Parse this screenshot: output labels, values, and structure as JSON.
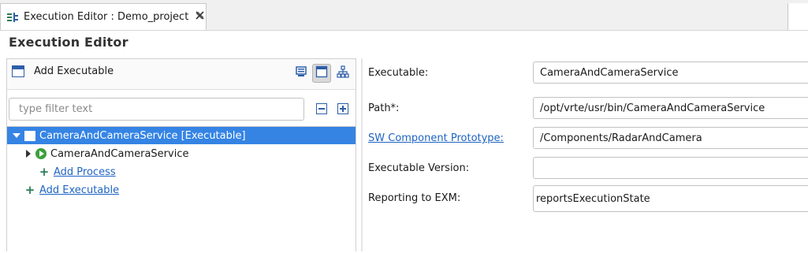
{
  "tab": {
    "title": "Execution Editor : Demo_project",
    "icon": "execution-editor-icon",
    "close_icon": "close-icon"
  },
  "editor": {
    "title": "Execution Editor"
  },
  "toolbar": {
    "add_label": "Add Executable",
    "buttons": [
      "monitor-view-icon",
      "window-view-icon",
      "hierarchy-view-icon"
    ],
    "active_button": "window-view-icon"
  },
  "filter": {
    "placeholder": "type filter text",
    "value": ""
  },
  "tree": {
    "root_label": "CameraAndCameraService [Executable]",
    "child_label": "CameraAndCameraService",
    "add_process_label": "Add Process",
    "add_executable_label": "Add Executable"
  },
  "properties": {
    "executable_label": "Executable:",
    "executable_value": "CameraAndCameraService",
    "path_label": "Path*:",
    "path_value": "/opt/vrte/usr/bin/CameraAndCameraService",
    "swc_label": "SW Component Prototype:",
    "swc_value": "/Components/RadarAndCamera",
    "version_label": "Executable Version:",
    "version_value": "",
    "reporting_label": "Reporting to EXM:",
    "reporting_value": "reportsExecutionState"
  },
  "colors": {
    "selection": "#3584e4",
    "link": "#1f64c2",
    "accent": "#2d5ea8"
  }
}
